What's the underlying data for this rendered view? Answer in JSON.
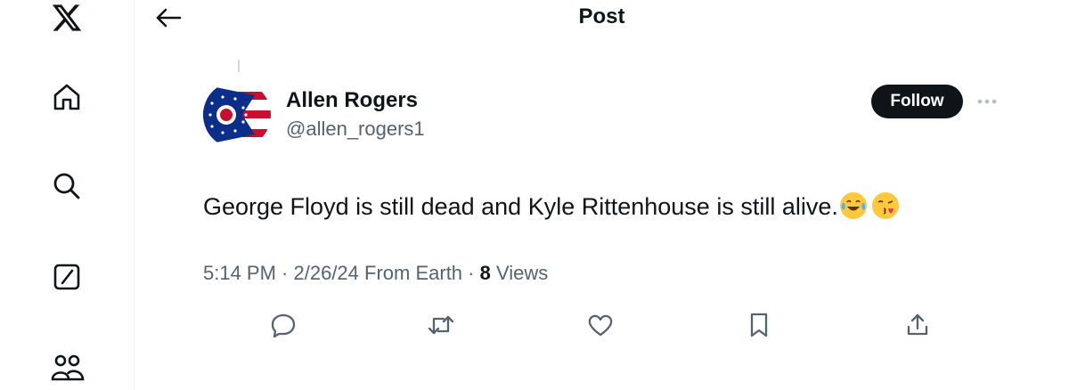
{
  "sidebar": {
    "items": [
      {
        "name": "x-logo-icon"
      },
      {
        "name": "home-icon"
      },
      {
        "name": "search-icon"
      },
      {
        "name": "grok-icon"
      },
      {
        "name": "communities-icon"
      }
    ]
  },
  "header": {
    "title": "Post"
  },
  "post": {
    "author": {
      "display_name": "Allen Rogers",
      "handle": "@allen_rogers1",
      "avatar": "ohio-flag-avatar"
    },
    "follow_label": "Follow",
    "text": "George Floyd is still dead and Kyle Rittenhouse is still alive.",
    "emojis": [
      "tears-of-joy-emoji",
      "kissing-face-emoji"
    ],
    "meta": {
      "time": "5:14 PM",
      "sep1": " · ",
      "date": "2/26/24",
      "location": " From Earth",
      "sep2": " · ",
      "views_count": "8",
      "views_label": " Views"
    },
    "actions": [
      "reply-icon",
      "repost-icon",
      "like-icon",
      "bookmark-icon",
      "share-icon"
    ]
  },
  "colors": {
    "text": "#0f1419",
    "secondary": "#536471",
    "border": "#eff3f4",
    "follow_bg": "#0f1419"
  }
}
